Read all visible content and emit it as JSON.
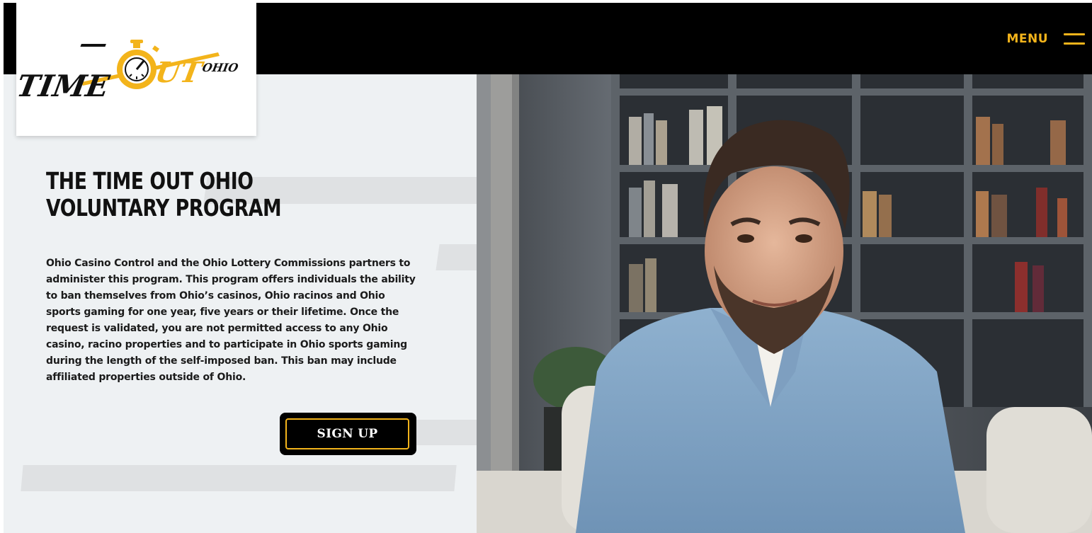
{
  "header": {
    "menu_label": "MENU",
    "menu_icon": "hamburger-icon",
    "accent_color": "#f3b41b"
  },
  "logo": {
    "text": "TIMEOUTOHIO",
    "icon": "stopwatch-icon"
  },
  "main": {
    "title": "THE TIME OUT OHIO VOLUNTARY PROGRAM",
    "description": "Ohio Casino Control and the Ohio Lottery Commissions partners to administer this program. This program offers individuals the ability to ban themselves from Ohio’s casinos, Ohio racinos and Ohio sports gaming for one year, five years or their lifetime. Once the request is validated, you are not permitted access to any Ohio casino, racino properties and to participate in Ohio sports gaming during the length of the self-imposed ban. This ban may include affiliated properties outside of Ohio.",
    "signup_label": "SIGN UP"
  },
  "hero_image": {
    "subject": "smiling-man-denim-shirt-photo"
  }
}
